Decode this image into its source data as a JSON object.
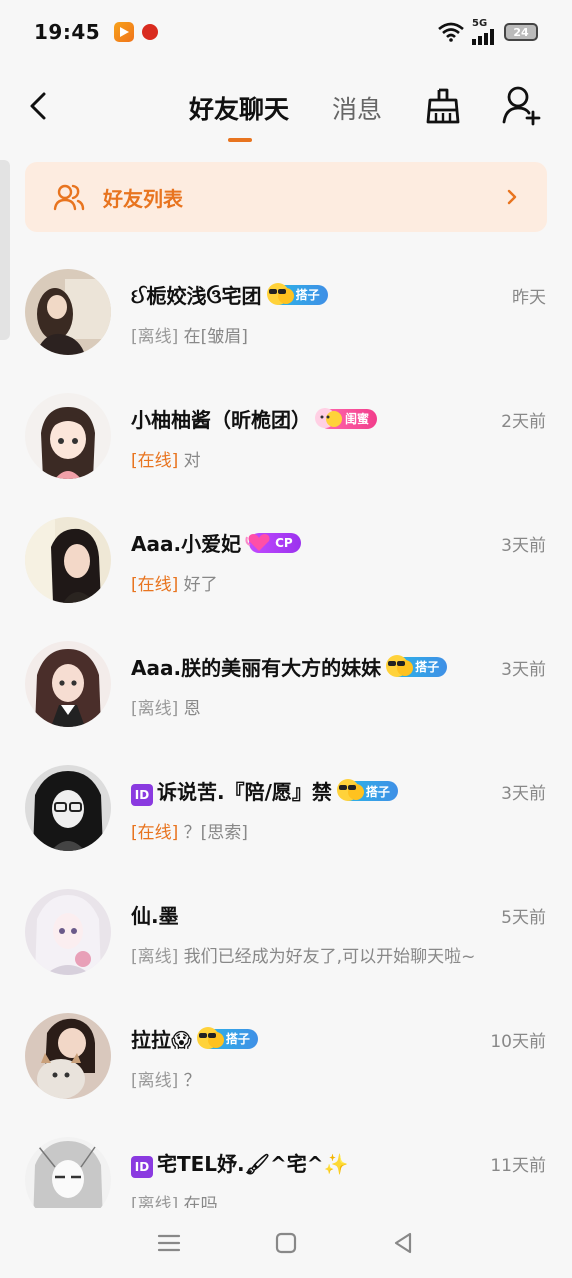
{
  "status_bar": {
    "time": "19:45",
    "network": "5G",
    "battery": "24"
  },
  "header": {
    "tabs": [
      {
        "label": "好友聊天",
        "active": true
      },
      {
        "label": "消息",
        "active": false
      }
    ],
    "accent_color": "#e8741f"
  },
  "friend_list_card": {
    "label": "好友列表"
  },
  "chats": [
    {
      "name": "ઈ栀姣浅ઉ宅团",
      "badge": {
        "type": "partner",
        "label": "搭子"
      },
      "time": "昨天",
      "status": "[离线]",
      "online": false,
      "message": "在[皱眉]"
    },
    {
      "name": "小柚柚酱（昕桅团）",
      "badge": {
        "type": "bestie",
        "label": "闺蜜"
      },
      "time": "2天前",
      "status": "[在线]",
      "online": true,
      "message": "对"
    },
    {
      "name": "Aaa.小爱妃",
      "badge": {
        "type": "cp",
        "label": "CP"
      },
      "time": "3天前",
      "status": "[在线]",
      "online": true,
      "message": "好了"
    },
    {
      "name": "Aaa.朕的美丽有大方的妹妹",
      "badge": {
        "type": "partner",
        "label": "搭子"
      },
      "time": "3天前",
      "status": "[离线]",
      "online": false,
      "message": "恩"
    },
    {
      "name": "诉说苦.『陪/愿』禁",
      "id_prefix": "ID",
      "badge": {
        "type": "partner",
        "label": "搭子"
      },
      "time": "3天前",
      "status": "[在线]",
      "online": true,
      "message": "？[思索]"
    },
    {
      "name": "仙.墨",
      "time": "5天前",
      "status": "[离线]",
      "online": false,
      "message": "我们已经成为好友了,可以开始聊天啦~"
    },
    {
      "name": "拉拉😱",
      "badge": {
        "type": "partner",
        "label": "搭子"
      },
      "time": "10天前",
      "status": "[离线]",
      "online": false,
      "message": "？"
    },
    {
      "name": "宅TEL妤.🖌^宅^✨",
      "id_prefix": "ID",
      "time": "11天前",
      "status": "[离线]",
      "online": false,
      "message": "在吗"
    }
  ]
}
